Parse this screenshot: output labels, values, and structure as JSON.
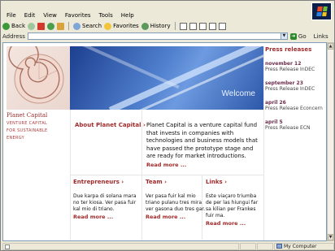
{
  "menu": {
    "file": "File",
    "edit": "Edit",
    "view": "View",
    "favorites": "Favorites",
    "tools": "Tools",
    "help": "Help"
  },
  "toolbar": {
    "back": "Back",
    "search": "Search",
    "favorites": "Favorites",
    "history": "History"
  },
  "address": {
    "label": "Address",
    "value": "",
    "go": "Go",
    "links": "Links"
  },
  "brand": {
    "name": "Planet Capital",
    "tagline1": "Venture capital",
    "tagline2": "for sustainable",
    "tagline3": "energy"
  },
  "hero": {
    "welcome": "Welcome"
  },
  "press": {
    "title": "Press releases",
    "items": [
      {
        "date": "november 12",
        "text": "Press Release InDEC"
      },
      {
        "date": "september 23",
        "text": "Press Release InDEC"
      },
      {
        "date": "april 26",
        "text": "Press Release Econcern"
      },
      {
        "date": "april 5",
        "text": "Press Release ECN"
      }
    ]
  },
  "about": {
    "heading": "About Planet Capital",
    "text": "Planet Capital is a venture capital fund that invests in companies with technologies and business models that have passed the prototype stage and are ready for market introductions.",
    "read_more": "Read more ..."
  },
  "columns": [
    {
      "heading": "Entrepreneurs",
      "text": "Due karpa di solana mara no ter kiosa. Ver pasa fuir kal mio di triano.",
      "read_more": "Read more ..."
    },
    {
      "heading": "Team",
      "text": "Ver pasa fuir kal mio triano pulanu tres mira ver gasona duo tres gar.",
      "read_more": "Read more ..."
    },
    {
      "heading": "Links",
      "text": "Este viaçaro triumba de per las hiungui far sa kilian per Frankes fuir ma.",
      "read_more": "Read more ..."
    }
  ],
  "status": {
    "zone": "My Computer"
  }
}
